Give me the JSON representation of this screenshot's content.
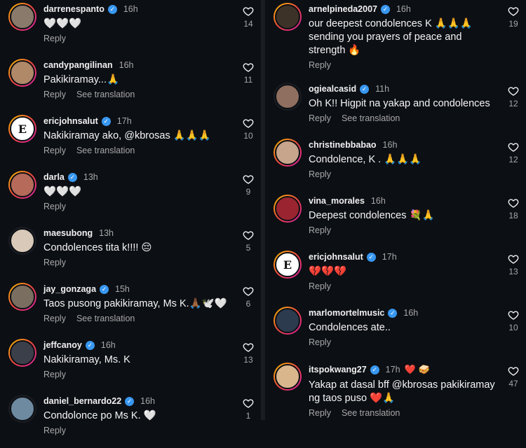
{
  "left": [
    {
      "user": "darrenespanto",
      "verified": true,
      "time": "16h",
      "text": "🤍🤍🤍",
      "actions": [
        "Reply"
      ],
      "likes": "14"
    },
    {
      "user": "candypangilinan",
      "verified": false,
      "time": "16h",
      "text": "Pakikiramay...🙏",
      "actions": [
        "Reply",
        "See translation"
      ],
      "likes": "11"
    },
    {
      "user": "ericjohnsalut",
      "verified": true,
      "time": "17h",
      "text": "Nakikiramay ako, @kbrosas 🙏🙏🙏",
      "actions": [
        "Reply",
        "See translation"
      ],
      "likes": "10"
    },
    {
      "user": "darla",
      "verified": true,
      "time": "13h",
      "text": "🤍🤍🤍",
      "actions": [
        "Reply"
      ],
      "likes": "9"
    },
    {
      "user": "maesubong",
      "verified": false,
      "time": "13h",
      "text": "Condolences tita k!!!! 😔",
      "actions": [
        "Reply"
      ],
      "likes": "5"
    },
    {
      "user": "jay_gonzaga",
      "verified": true,
      "time": "15h",
      "text": "Taos pusong pakikiramay, Ms K.🙏🏾🕊️🤍",
      "actions": [
        "Reply",
        "See translation"
      ],
      "likes": "6"
    },
    {
      "user": "jeffcanoy",
      "verified": true,
      "time": "16h",
      "text": "Nakikiramay, Ms. K",
      "actions": [
        "Reply"
      ],
      "likes": "13"
    },
    {
      "user": "daniel_bernardo22",
      "verified": true,
      "time": "16h",
      "text": "Condolonce po Ms K. 🤍",
      "actions": [
        "Reply"
      ],
      "likes": "1"
    }
  ],
  "right": [
    {
      "user": "arnelpineda2007",
      "verified": true,
      "time": "16h",
      "text": "our deepest condolences K 🙏🙏🙏 sending you prayers of peace and strength 🔥",
      "actions": [
        "Reply"
      ],
      "likes": "19"
    },
    {
      "user": "ogiealcasid",
      "verified": true,
      "time": "11h",
      "text": "Oh K!! Higpit na yakap and condolences",
      "actions": [
        "Reply",
        "See translation"
      ],
      "likes": "12"
    },
    {
      "user": "christinebbabao",
      "verified": false,
      "time": "16h",
      "text": "Condolence, K . 🙏🙏🙏",
      "actions": [
        "Reply"
      ],
      "likes": "12"
    },
    {
      "user": "vina_morales",
      "verified": false,
      "time": "16h",
      "text": "Deepest condolences 💐🙏",
      "actions": [
        "Reply"
      ],
      "likes": "18"
    },
    {
      "user": "ericjohnsalut",
      "verified": true,
      "time": "17h",
      "text": "💔💔💔",
      "actions": [
        "Reply"
      ],
      "likes": "13"
    },
    {
      "user": "marlomortelmusic",
      "verified": true,
      "time": "16h",
      "text": "Condolences ate..",
      "actions": [
        "Reply"
      ],
      "likes": "10"
    },
    {
      "user": "itspokwang27",
      "verified": true,
      "time": "17h",
      "meta_extra": [
        "❤️",
        "🥪"
      ],
      "text": "Yakap at dasal bff @kbrosas pakikiramay ng taos puso ❤️🙏",
      "actions": [
        "Reply",
        "See translation"
      ],
      "likes": "47"
    }
  ],
  "colors": {
    "background": "#0c0f14",
    "verified": "#3897f0",
    "muted": "#a8a8a8"
  }
}
